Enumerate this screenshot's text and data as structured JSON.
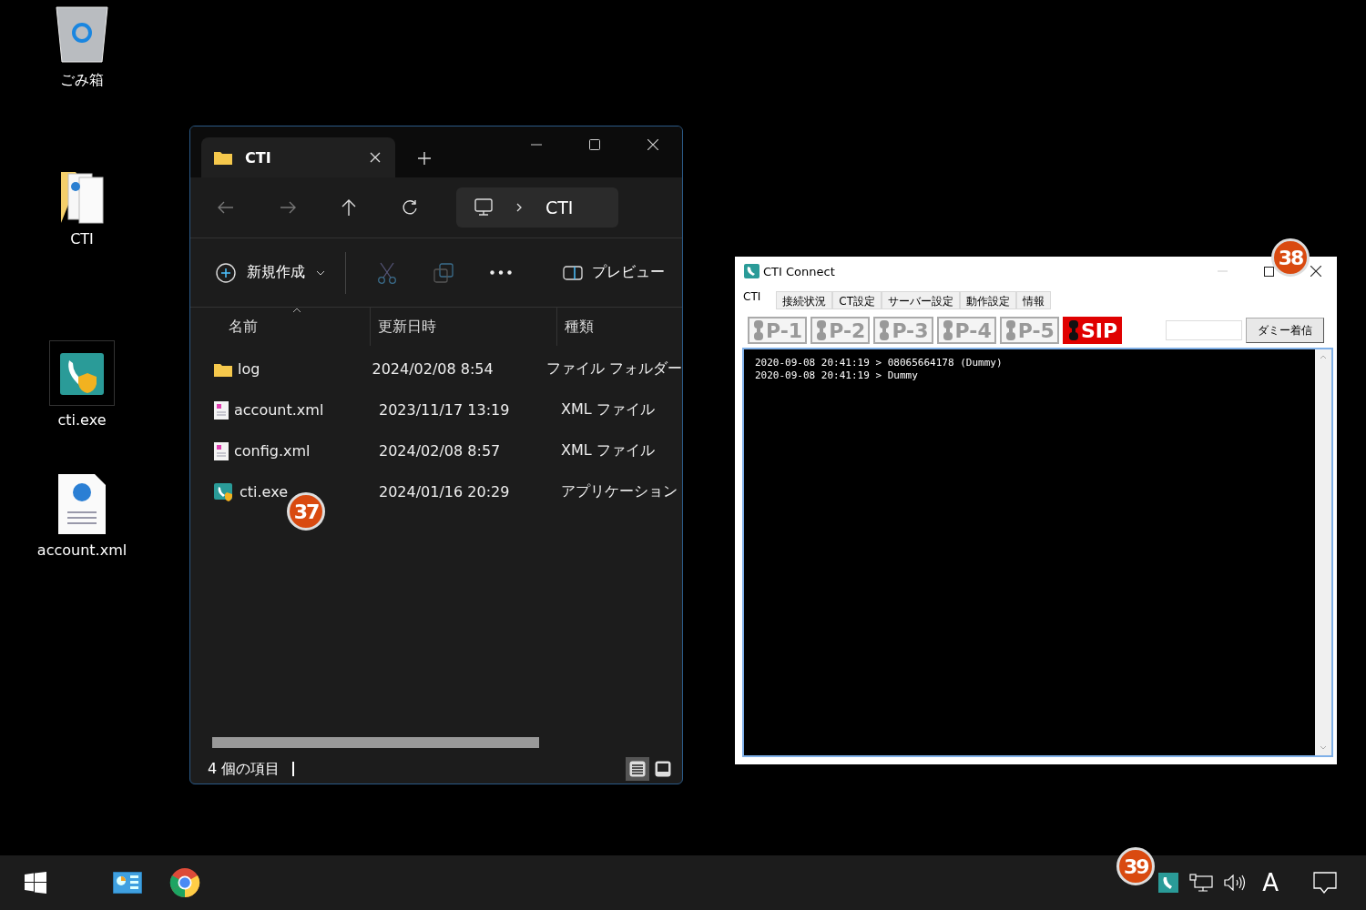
{
  "desktop_icons": [
    {
      "kind": "recycle-bin",
      "label": "ごみ箱"
    },
    {
      "kind": "folder",
      "label": "CTI"
    },
    {
      "kind": "app",
      "label": "cti.exe"
    },
    {
      "kind": "xml",
      "label": "account.xml"
    }
  ],
  "explorer": {
    "tab_title": "CTI",
    "breadcrumb": "CTI",
    "new_label": "新規作成",
    "preview_label": "プレビュー",
    "columns": [
      "名前",
      "更新日時",
      "種類"
    ],
    "rows": [
      {
        "kind": "folder",
        "name": "log",
        "modified": "2024/02/08 8:54",
        "type": "ファイル フォルダー"
      },
      {
        "kind": "xml",
        "name": "account.xml",
        "modified": "2023/11/17 13:19",
        "type": "XML ファイル"
      },
      {
        "kind": "xml",
        "name": "config.xml",
        "modified": "2024/02/08 8:57",
        "type": "XML ファイル"
      },
      {
        "kind": "app",
        "name": "cti.exe",
        "modified": "2024/01/16 20:29",
        "type": "アプリケーション"
      }
    ],
    "status": "4 個の項目",
    "callout": "37",
    "view_buttons": [
      {
        "kind": "details",
        "selected": true
      },
      {
        "kind": "tiles",
        "selected": false
      }
    ]
  },
  "cti_connect": {
    "title": "CTI Connect",
    "callout": "38",
    "tabs": [
      {
        "label": "CTI",
        "selected": true
      },
      {
        "label": "接続状況",
        "selected": false
      },
      {
        "label": "CT設定",
        "selected": false
      },
      {
        "label": "サーバー設定",
        "selected": false
      },
      {
        "label": "動作設定",
        "selected": false
      },
      {
        "label": "情報",
        "selected": false
      }
    ],
    "lines": [
      {
        "label": "P-1",
        "active": false
      },
      {
        "label": "P-2",
        "active": false
      },
      {
        "label": "P-3",
        "active": false
      },
      {
        "label": "P-4",
        "active": false
      },
      {
        "label": "P-5",
        "active": false
      },
      {
        "label": "SIP",
        "active": true
      }
    ],
    "dummy_button": "ダミー着信",
    "log": [
      "2020-09-08 20:41:19 > 08065664178 (Dummy)",
      "2020-09-08 20:41:19 > Dummy"
    ]
  },
  "taskbar": {
    "callout": "39",
    "ime": "A"
  }
}
